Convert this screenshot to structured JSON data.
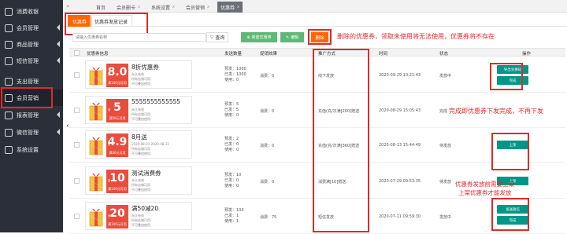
{
  "sidebar": {
    "items": [
      {
        "label": "消费收银",
        "icon": "cash-register-icon"
      },
      {
        "label": "会员管理",
        "icon": "user-icon"
      },
      {
        "label": "商品管理",
        "icon": "goods-icon"
      },
      {
        "label": "短信管理",
        "icon": "sms-icon"
      },
      {
        "label": "支出管理",
        "icon": "expense-icon"
      },
      {
        "label": "会员营销",
        "icon": "marketing-icon"
      },
      {
        "label": "报表管理",
        "icon": "report-icon"
      },
      {
        "label": "微信管理",
        "icon": "wechat-icon"
      },
      {
        "label": "系统设置",
        "icon": "settings-icon"
      }
    ]
  },
  "top_tabs": [
    "首页",
    "会员删卡",
    "系统设置",
    "会员营销",
    "优惠券"
  ],
  "sub_tabs": [
    "优惠券",
    "优惠券发放记录"
  ],
  "toolbar": {
    "search_placeholder": "请输入优惠券名称",
    "query": "查询",
    "new": "新建优惠券",
    "edit": "编辑",
    "delete": "删除"
  },
  "annotations": {
    "delete_note": "删除的优惠券，领取未使用将无法使用，优惠券将不存在",
    "complete_note": "完成即优惠券下发完成，不再下发",
    "publish_note_1": "优惠券发放前需要上架",
    "publish_note_2": "上架优惠券才能发放"
  },
  "table": {
    "headers": [
      "优惠券信息",
      "发送数量",
      "促销效果",
      "推广方式",
      "时间",
      "状态",
      "操作"
    ],
    "rows": [
      {
        "value": "8.0",
        "unit": "折",
        "condition": "满100元可用",
        "name": "8折优惠券",
        "validity": "永久有效",
        "scope": "所有店铺可用",
        "share": "不可叠加使用",
        "preset": "预发：1000",
        "sent": "已发：1000",
        "used": "使用：0",
        "effect": "消费：0",
        "method": "线下发放",
        "time": "2020-09-29 10:21:43",
        "status": "发放中",
        "actions": [
          "导出兑换码",
          "完成"
        ]
      },
      {
        "value": "5",
        "unit": "",
        "condition": "满50元可用",
        "name": "5555555555555",
        "validity": "永久有效",
        "scope": "所有店铺可用",
        "share": "不可叠加使用",
        "preset": "预发：5",
        "sent": "已发：5",
        "used": "使用：0",
        "effect": "消费：0",
        "method": "充值(充/次满[200]赠送",
        "time": "2020-08-29 15:05:43",
        "status": "完成",
        "actions": []
      },
      {
        "value": "4.9",
        "unit": "折",
        "condition": "满30元可用",
        "name": "8月送",
        "validity": "2020-08-01-2020-08-31",
        "scope": "所有店铺可用",
        "share": "不可叠加使用",
        "preset": "预发：2",
        "sent": "已发：0",
        "used": "使用：0",
        "effect": "消费：0",
        "method": "充值(充/次满[360]赠送",
        "time": "2020-08-13 15:44:49",
        "status": "待发放",
        "actions": [
          "上架"
        ]
      },
      {
        "value": "10",
        "unit": "",
        "condition": "满100元可用",
        "name": "测试消费券",
        "validity": "永久有效",
        "scope": "所有店铺可用",
        "share": "不可叠加使用",
        "preset": "预发：10",
        "sent": "已发：0",
        "used": "使用：0",
        "effect": "消费：0",
        "method": "消费满[10]赠送",
        "time": "2020-07-29 09:53:35",
        "status": "待发放",
        "actions": [
          "上架"
        ]
      },
      {
        "value": "20",
        "unit": "",
        "condition": "满100元可用",
        "name": "满50减20",
        "validity": "永久有效",
        "scope": "所有店铺可用",
        "share": "不可叠加使用",
        "preset": "预发：100",
        "sent": "已发：1",
        "used": "使用：1",
        "effect": "消费：75",
        "method": "短信发放",
        "time": "2020-07-11 09:59:30",
        "status": "发放中",
        "actions": [
          "发送短信",
          "完成"
        ]
      }
    ]
  },
  "colors": {
    "accent": "#ff6600",
    "primary_green": "#009688",
    "ticket_red": "#e84d3d",
    "annotation_red": "#e02a2a",
    "sidebar_bg": "#2b2f3a"
  }
}
